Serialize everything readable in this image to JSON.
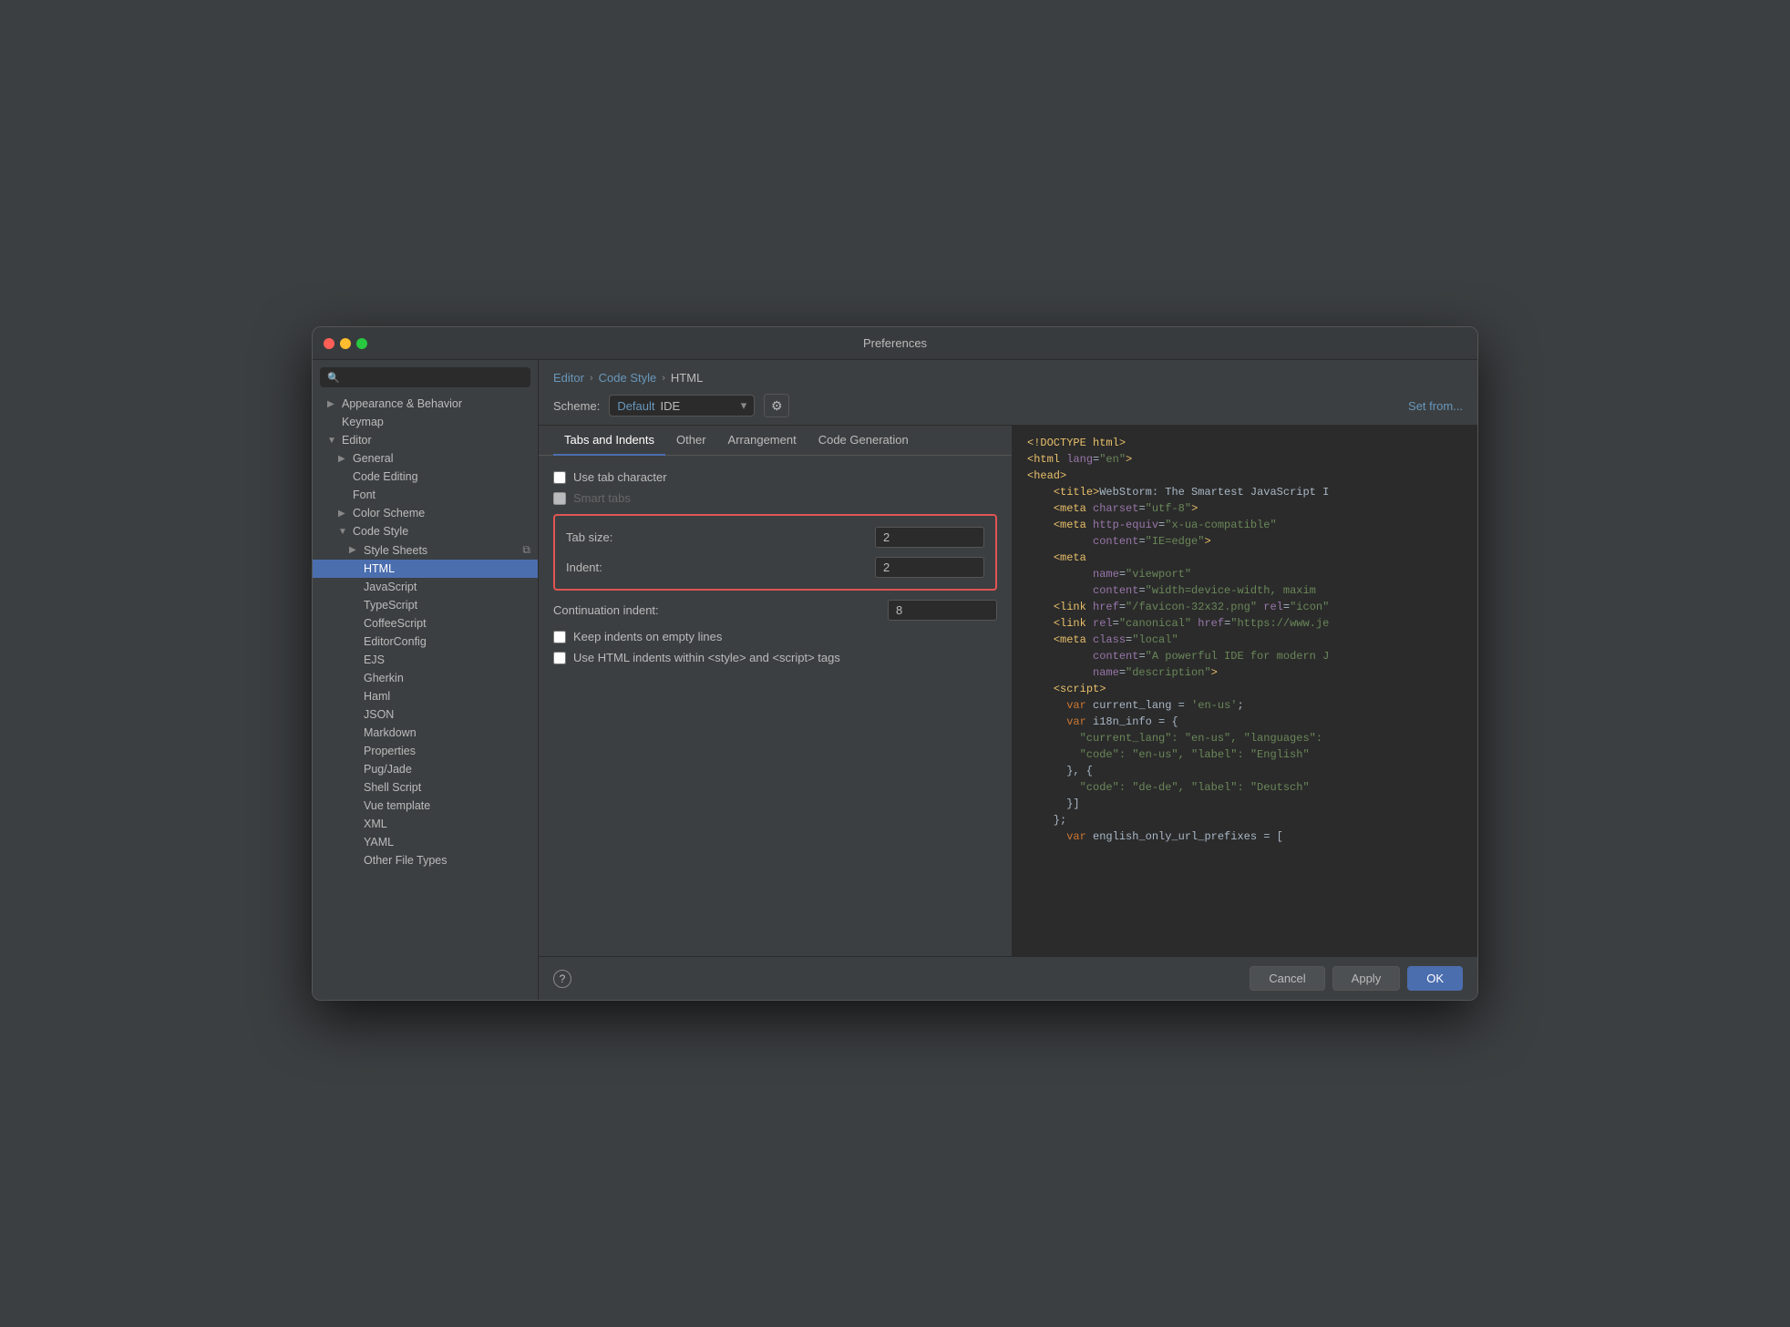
{
  "window": {
    "title": "Preferences"
  },
  "sidebar": {
    "search_placeholder": "🔍",
    "items": [
      {
        "id": "appearance-behavior",
        "label": "Appearance & Behavior",
        "level": 1,
        "has_arrow": true,
        "expanded": false,
        "selected": false
      },
      {
        "id": "keymap",
        "label": "Keymap",
        "level": 1,
        "has_arrow": false,
        "expanded": false,
        "selected": false
      },
      {
        "id": "editor",
        "label": "Editor",
        "level": 1,
        "has_arrow": true,
        "expanded": true,
        "selected": false
      },
      {
        "id": "general",
        "label": "General",
        "level": 2,
        "has_arrow": true,
        "expanded": false,
        "selected": false
      },
      {
        "id": "code-editing",
        "label": "Code Editing",
        "level": 2,
        "has_arrow": false,
        "expanded": false,
        "selected": false
      },
      {
        "id": "font",
        "label": "Font",
        "level": 2,
        "has_arrow": false,
        "expanded": false,
        "selected": false
      },
      {
        "id": "color-scheme",
        "label": "Color Scheme",
        "level": 2,
        "has_arrow": true,
        "expanded": false,
        "selected": false
      },
      {
        "id": "code-style",
        "label": "Code Style",
        "level": 2,
        "has_arrow": true,
        "expanded": true,
        "selected": false
      },
      {
        "id": "style-sheets",
        "label": "Style Sheets",
        "level": 3,
        "has_arrow": true,
        "expanded": false,
        "selected": false,
        "has_copy": true
      },
      {
        "id": "html",
        "label": "HTML",
        "level": 3,
        "has_arrow": false,
        "expanded": false,
        "selected": true
      },
      {
        "id": "javascript",
        "label": "JavaScript",
        "level": 3,
        "has_arrow": false,
        "expanded": false,
        "selected": false
      },
      {
        "id": "typescript",
        "label": "TypeScript",
        "level": 3,
        "has_arrow": false,
        "expanded": false,
        "selected": false
      },
      {
        "id": "coffeescript",
        "label": "CoffeeScript",
        "level": 3,
        "has_arrow": false,
        "expanded": false,
        "selected": false
      },
      {
        "id": "editorconfig",
        "label": "EditorConfig",
        "level": 3,
        "has_arrow": false,
        "expanded": false,
        "selected": false
      },
      {
        "id": "ejs",
        "label": "EJS",
        "level": 3,
        "has_arrow": false,
        "expanded": false,
        "selected": false
      },
      {
        "id": "gherkin",
        "label": "Gherkin",
        "level": 3,
        "has_arrow": false,
        "expanded": false,
        "selected": false
      },
      {
        "id": "haml",
        "label": "Haml",
        "level": 3,
        "has_arrow": false,
        "expanded": false,
        "selected": false
      },
      {
        "id": "json",
        "label": "JSON",
        "level": 3,
        "has_arrow": false,
        "expanded": false,
        "selected": false
      },
      {
        "id": "markdown",
        "label": "Markdown",
        "level": 3,
        "has_arrow": false,
        "expanded": false,
        "selected": false
      },
      {
        "id": "properties",
        "label": "Properties",
        "level": 3,
        "has_arrow": false,
        "expanded": false,
        "selected": false
      },
      {
        "id": "pug-jade",
        "label": "Pug/Jade",
        "level": 3,
        "has_arrow": false,
        "expanded": false,
        "selected": false
      },
      {
        "id": "shell-script",
        "label": "Shell Script",
        "level": 3,
        "has_arrow": false,
        "expanded": false,
        "selected": false
      },
      {
        "id": "vue-template",
        "label": "Vue template",
        "level": 3,
        "has_arrow": false,
        "expanded": false,
        "selected": false
      },
      {
        "id": "xml",
        "label": "XML",
        "level": 3,
        "has_arrow": false,
        "expanded": false,
        "selected": false
      },
      {
        "id": "yaml",
        "label": "YAML",
        "level": 3,
        "has_arrow": false,
        "expanded": false,
        "selected": false
      },
      {
        "id": "other-file-types",
        "label": "Other File Types",
        "level": 3,
        "has_arrow": false,
        "expanded": false,
        "selected": false
      }
    ]
  },
  "header": {
    "breadcrumb": {
      "parts": [
        "Editor",
        "Code Style",
        "HTML"
      ]
    },
    "scheme_label": "Scheme:",
    "scheme_value": "Default",
    "scheme_ide": "IDE",
    "set_from_label": "Set from..."
  },
  "tabs": [
    {
      "id": "tabs-indents",
      "label": "Tabs and Indents",
      "active": true
    },
    {
      "id": "other",
      "label": "Other",
      "active": false
    },
    {
      "id": "arrangement",
      "label": "Arrangement",
      "active": false
    },
    {
      "id": "code-generation",
      "label": "Code Generation",
      "active": false
    }
  ],
  "settings": {
    "use_tab_character": {
      "label": "Use tab character",
      "checked": false
    },
    "smart_tabs": {
      "label": "Smart tabs",
      "checked": false,
      "disabled": true
    },
    "tab_size": {
      "label": "Tab size:",
      "value": "2"
    },
    "indent": {
      "label": "Indent:",
      "value": "2"
    },
    "continuation_indent": {
      "label": "Continuation indent:",
      "value": "8"
    },
    "keep_indents_empty": {
      "label": "Keep indents on empty lines",
      "checked": false
    },
    "use_html_indents": {
      "label": "Use HTML indents within <style> and <script> tags",
      "checked": false
    }
  },
  "code_preview": {
    "lines": [
      {
        "parts": [
          {
            "text": "<!DOCTYPE html>",
            "class": "tag"
          }
        ]
      },
      {
        "parts": [
          {
            "text": "<html ",
            "class": "tag"
          },
          {
            "text": "lang",
            "class": "attr"
          },
          {
            "text": "=",
            "class": "text"
          },
          {
            "text": "\"en\"",
            "class": "value"
          },
          {
            "text": ">",
            "class": "tag"
          }
        ]
      },
      {
        "parts": [
          {
            "text": "<head>",
            "class": "tag"
          }
        ]
      },
      {
        "parts": [
          {
            "text": "    <title>",
            "class": "tag"
          },
          {
            "text": "WebStorm: The Smartest JavaScript I",
            "class": "text"
          }
        ]
      },
      {
        "parts": [
          {
            "text": "    <meta ",
            "class": "tag"
          },
          {
            "text": "charset",
            "class": "attr"
          },
          {
            "text": "=",
            "class": "text"
          },
          {
            "text": "\"utf-8\"",
            "class": "value"
          },
          {
            "text": ">",
            "class": "tag"
          }
        ]
      },
      {
        "parts": [
          {
            "text": "    <meta ",
            "class": "tag"
          },
          {
            "text": "http-equiv",
            "class": "attr"
          },
          {
            "text": "=",
            "class": "text"
          },
          {
            "text": "\"x-ua-compatible\"",
            "class": "value"
          }
        ]
      },
      {
        "parts": [
          {
            "text": "          ",
            "class": "text"
          },
          {
            "text": "content",
            "class": "attr"
          },
          {
            "text": "=",
            "class": "text"
          },
          {
            "text": "\"IE=edge\"",
            "class": "value"
          },
          {
            "text": ">",
            "class": "tag"
          }
        ]
      },
      {
        "parts": [
          {
            "text": "    <meta",
            "class": "tag"
          }
        ]
      },
      {
        "parts": [
          {
            "text": "          ",
            "class": "text"
          },
          {
            "text": "name",
            "class": "attr"
          },
          {
            "text": "=",
            "class": "text"
          },
          {
            "text": "\"viewport\"",
            "class": "value"
          }
        ]
      },
      {
        "parts": [
          {
            "text": "          ",
            "class": "text"
          },
          {
            "text": "content",
            "class": "attr"
          },
          {
            "text": "=",
            "class": "text"
          },
          {
            "text": "\"width=device-width, maxim",
            "class": "value"
          }
        ]
      },
      {
        "parts": [
          {
            "text": "    <link ",
            "class": "tag"
          },
          {
            "text": "href",
            "class": "attr"
          },
          {
            "text": "=",
            "class": "text"
          },
          {
            "text": "\"/favicon-32x32.png\" ",
            "class": "value"
          },
          {
            "text": "rel",
            "class": "attr"
          },
          {
            "text": "=",
            "class": "text"
          },
          {
            "text": "\"icon\"",
            "class": "value"
          }
        ]
      },
      {
        "parts": [
          {
            "text": "    <link ",
            "class": "tag"
          },
          {
            "text": "rel",
            "class": "attr"
          },
          {
            "text": "=",
            "class": "text"
          },
          {
            "text": "\"canonical\" ",
            "class": "value"
          },
          {
            "text": "href",
            "class": "attr"
          },
          {
            "text": "=",
            "class": "text"
          },
          {
            "text": "\"https://www.je",
            "class": "value"
          }
        ]
      },
      {
        "parts": [
          {
            "text": "    <meta ",
            "class": "tag"
          },
          {
            "text": "class",
            "class": "attr"
          },
          {
            "text": "=",
            "class": "text"
          },
          {
            "text": "\"local\"",
            "class": "value"
          }
        ]
      },
      {
        "parts": [
          {
            "text": "          ",
            "class": "text"
          },
          {
            "text": "content",
            "class": "attr"
          },
          {
            "text": "=",
            "class": "text"
          },
          {
            "text": "\"A powerful IDE for modern J",
            "class": "value"
          }
        ]
      },
      {
        "parts": [
          {
            "text": "          ",
            "class": "text"
          },
          {
            "text": "name",
            "class": "attr"
          },
          {
            "text": "=",
            "class": "text"
          },
          {
            "text": "\"description\"",
            "class": "value"
          },
          {
            "text": ">",
            "class": "tag"
          }
        ]
      },
      {
        "parts": [
          {
            "text": "    <script>",
            "class": "tag"
          }
        ]
      },
      {
        "parts": [
          {
            "text": "      ",
            "class": "text"
          },
          {
            "text": "var ",
            "class": "keyword"
          },
          {
            "text": "current_lang = ",
            "class": "text"
          },
          {
            "text": "'en-us'",
            "class": "string"
          },
          {
            "text": ";",
            "class": "text"
          }
        ]
      },
      {
        "parts": [
          {
            "text": "      ",
            "class": "text"
          },
          {
            "text": "var ",
            "class": "keyword"
          },
          {
            "text": "i18n_info = {",
            "class": "text"
          }
        ]
      },
      {
        "parts": [
          {
            "text": "        ",
            "class": "text"
          },
          {
            "text": "\"current_lang\": \"en-us\", \"languages\":",
            "class": "string"
          }
        ]
      },
      {
        "parts": [
          {
            "text": "        ",
            "class": "text"
          },
          {
            "text": "\"code\": \"en-us\", \"label\": \"English\"",
            "class": "string"
          }
        ]
      },
      {
        "parts": [
          {
            "text": "      }, {",
            "class": "text"
          }
        ]
      },
      {
        "parts": [
          {
            "text": "        ",
            "class": "text"
          },
          {
            "text": "\"code\": \"de-de\", \"label\": \"Deutsch\"",
            "class": "string"
          }
        ]
      },
      {
        "parts": [
          {
            "text": "      }]",
            "class": "text"
          }
        ]
      },
      {
        "parts": [
          {
            "text": "    };",
            "class": "text"
          }
        ]
      },
      {
        "parts": [
          {
            "text": "      ",
            "class": "text"
          },
          {
            "text": "var ",
            "class": "keyword"
          },
          {
            "text": "english_only_url_prefixes = [",
            "class": "text"
          }
        ]
      }
    ]
  },
  "buttons": {
    "cancel": "Cancel",
    "apply": "Apply",
    "ok": "OK"
  }
}
